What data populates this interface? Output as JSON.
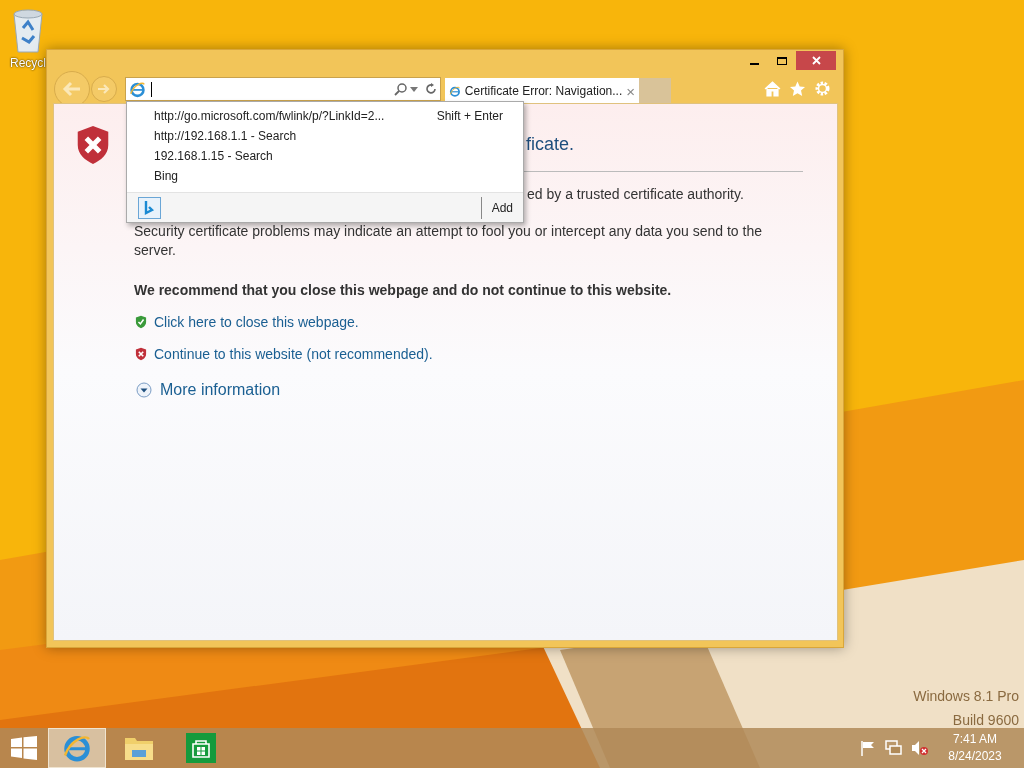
{
  "desktop": {
    "icons": [
      {
        "label": "Recycl"
      }
    ],
    "watermark": [
      "Windows 8.1 Pro",
      "Build 9600"
    ]
  },
  "browser": {
    "tabs": [
      {
        "title": "Certificate Error: Navigation...",
        "close": "×",
        "selected": true
      }
    ],
    "suggestions": [
      {
        "text": "http://go.microsoft.com/fwlink/p/?LinkId=2...",
        "hint": "Shift + Enter"
      },
      {
        "text": "http://192.168.1.1 - Search"
      },
      {
        "text": "192.168.1.15 - Search"
      },
      {
        "text": "Bing"
      }
    ],
    "suggestion_add": "Add",
    "page": {
      "heading": "ficate.",
      "subline": "ed by a trusted certificate authority.",
      "paragraph": "Security certificate problems may indicate an attempt to fool you or intercept any data you send to the server.",
      "recommendation": "We recommend that you close this webpage and do not continue to this website.",
      "links": [
        {
          "kind": "safe",
          "text": "Click here to close this webpage."
        },
        {
          "kind": "unsafe",
          "text": "Continue to this website (not recommended)."
        }
      ],
      "more_info": "More information"
    }
  },
  "taskbar": {
    "apps": [
      {
        "kind": "ie",
        "selected": true
      },
      {
        "kind": "explorer",
        "selected": false
      },
      {
        "kind": "store",
        "selected": false
      }
    ],
    "clock": {
      "time": "7:41 AM",
      "date": "8/24/2023"
    }
  }
}
